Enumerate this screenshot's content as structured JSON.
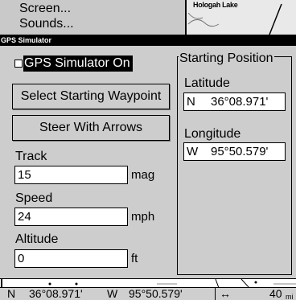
{
  "background": {
    "menu_items": [
      "Screen...",
      "Sounds..."
    ],
    "map_label": "Hologah Lake"
  },
  "dialog": {
    "title": "GPS Simulator",
    "simulator_on": {
      "label": "GPS Simulator On",
      "checked": false
    },
    "select_waypoint_button": "Select Starting Waypoint",
    "steer_arrows_button": "Steer With Arrows",
    "track": {
      "label": "Track",
      "value": "15",
      "unit": "mag"
    },
    "speed": {
      "label": "Speed",
      "value": "24",
      "unit": "mph"
    },
    "altitude": {
      "label": "Altitude",
      "value": "0",
      "unit": "ft"
    },
    "starting_position": {
      "title": "Starting Position",
      "latitude_label": "Latitude",
      "latitude_hemisphere": "N",
      "latitude_value": "36°08.971'",
      "longitude_label": "Longitude",
      "longitude_hemisphere": "W",
      "longitude_value": "95°50.579'"
    }
  },
  "statusbar": {
    "lat_hemisphere": "N",
    "lat_value": "36°08.971'",
    "lon_hemisphere": "W",
    "lon_value": "95°50.579'",
    "zoom_icon": "↔",
    "zoom_value": "40",
    "zoom_unit": "mi"
  }
}
